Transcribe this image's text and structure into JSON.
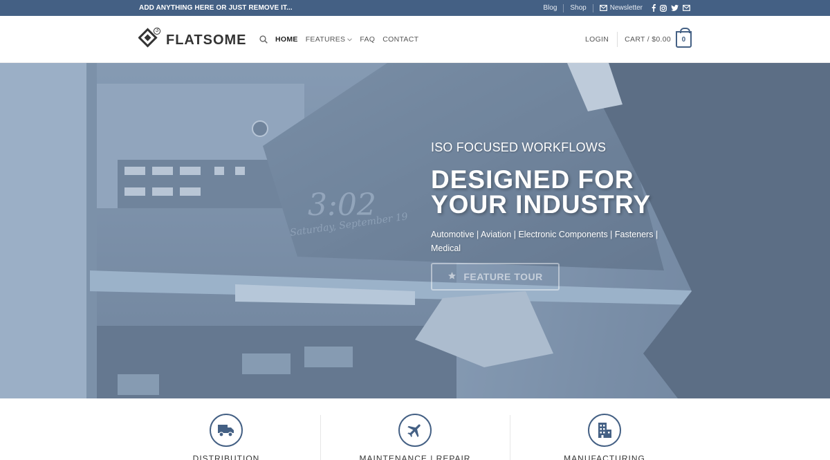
{
  "topbar": {
    "message": "ADD ANYTHING HERE OR JUST REMOVE IT...",
    "links": [
      "Blog",
      "Shop"
    ],
    "newsletter": "Newsletter",
    "social_icons": [
      "facebook-icon",
      "instagram-icon",
      "twitter-icon",
      "envelope-icon"
    ]
  },
  "header": {
    "logo_text": "FLATSOME",
    "logo_badge": "3",
    "nav": {
      "home": "HOME",
      "features": "FEATURES",
      "faq": "FAQ",
      "contact": "CONTACT"
    },
    "login": "LOGIN",
    "cart_label": "CART / $0.00",
    "cart_count": "0"
  },
  "hero": {
    "kicker": "ISO FOCUSED WORKFLOWS",
    "headline_line1": "DESIGNED FOR",
    "headline_line2": "YOUR INDUSTRY",
    "subline": "Automotive | Aviation | Electronic Components | Fasteners | Medical",
    "button": "FEATURE TOUR",
    "clock_time": "3:02",
    "clock_date": "Saturday, September 19"
  },
  "features": [
    {
      "label": "DISTRIBUTION",
      "icon": "truck-icon"
    },
    {
      "label": "MAINTENANCE | REPAIR",
      "icon": "airplane-icon"
    },
    {
      "label": "MANUFACTURING",
      "icon": "building-icon"
    }
  ],
  "colors": {
    "primary": "#446084",
    "topbar_bg": "#446084",
    "text_dark": "#333333"
  }
}
